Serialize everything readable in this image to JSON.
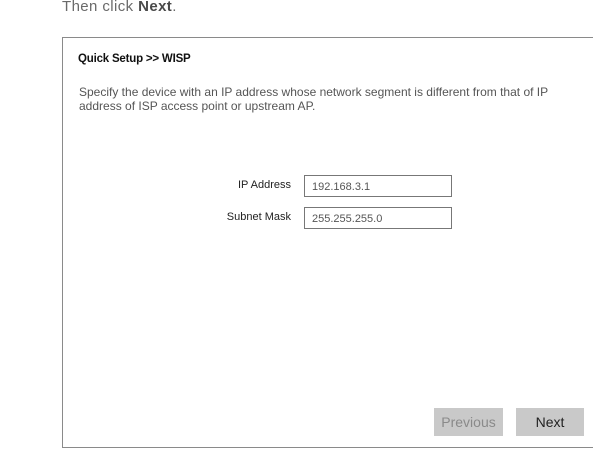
{
  "instruction": {
    "prefix": "Then click ",
    "emphasis": "Next",
    "suffix": "."
  },
  "panel": {
    "title": "Quick Setup >> WISP",
    "description": "Specify the device with an IP address whose network segment is different from that of IP address of ISP access point or upstream AP."
  },
  "form": {
    "ip_label": "IP Address",
    "ip_value": "192.168.3.1",
    "mask_label": "Subnet Mask",
    "mask_value": "255.255.255.0"
  },
  "buttons": {
    "previous": "Previous",
    "next": "Next"
  }
}
